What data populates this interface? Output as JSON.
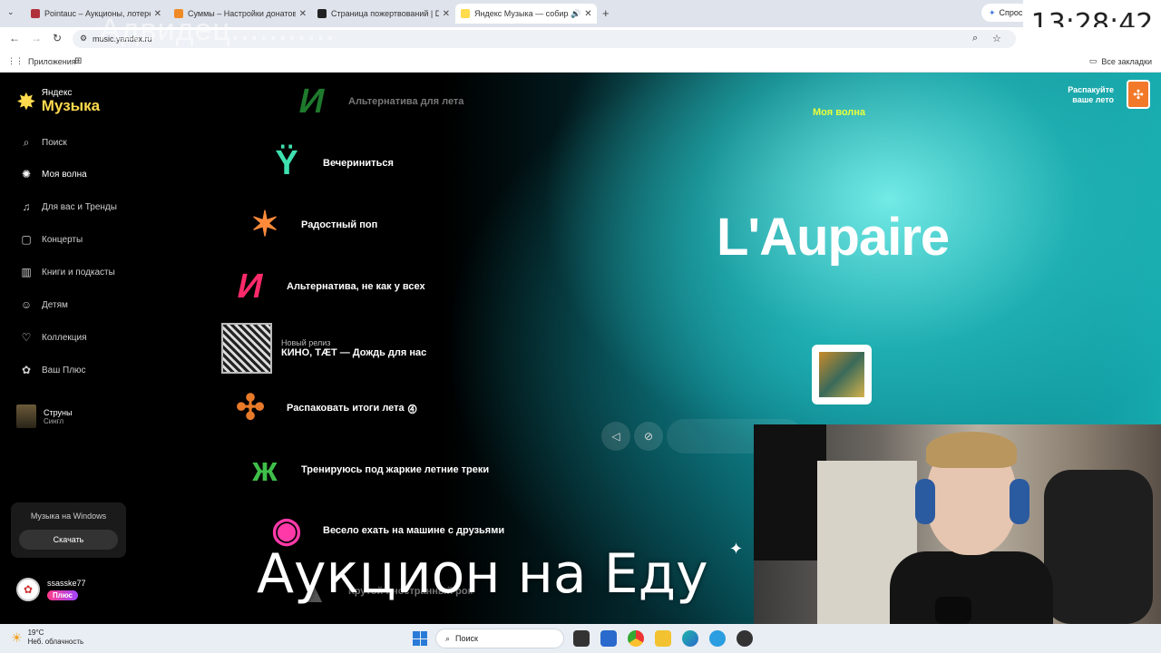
{
  "browser": {
    "tabs": [
      {
        "title": "Pointauc – Аукционы, лотереи",
        "color": "#b0303a",
        "active": false
      },
      {
        "title": "Суммы – Настройки донатов",
        "color": "#f08a24",
        "active": false
      },
      {
        "title": "Страница пожертвований | D",
        "color": "#222222",
        "active": false
      },
      {
        "title": "Яндекс Музыка — собирае",
        "color": "#ffdb4d",
        "active": true
      }
    ],
    "tab_close": "✕",
    "tab_new": "+",
    "gemini_label": "Спрос",
    "clock": "13:28:42",
    "address": "music.yandex.ru",
    "ghost_text": "Адвидец...........",
    "bookmarks_apps": "Приложения",
    "bookmarks_all": "Все закладки"
  },
  "sidebar": {
    "logo_top": "Яндекс",
    "logo_bottom": "Музыка",
    "items": [
      {
        "label": "Поиск",
        "icon": "⌕"
      },
      {
        "label": "Моя волна",
        "icon": "✺"
      },
      {
        "label": "Для вас и Тренды",
        "icon": "♫"
      },
      {
        "label": "Концерты",
        "icon": "▢"
      },
      {
        "label": "Книги и подкасты",
        "icon": "▥"
      },
      {
        "label": "Детям",
        "icon": "☺"
      },
      {
        "label": "Коллекция",
        "icon": "♡"
      },
      {
        "label": "Ваш Плюс",
        "icon": "✿"
      }
    ],
    "recent": {
      "title": "Струны",
      "subtitle": "Сингл"
    },
    "windows_card": {
      "title": "Музыка на Windows",
      "button": "Скачать"
    },
    "user": {
      "name": "ssasske77",
      "badge": "Плюс"
    }
  },
  "wave": {
    "items": [
      {
        "label": "Альтернатива для лета",
        "symbol": "И",
        "color": "#1e7a2c"
      },
      {
        "label": "Вечериниться",
        "symbol": "Ÿ",
        "color": "#3fe0b0"
      },
      {
        "label": "Радостный поп",
        "symbol": "✶",
        "color": "#ff8a3a"
      },
      {
        "label": "Альтернатива, не как у всех",
        "symbol": "И",
        "color": "#ff2a6a"
      },
      {
        "label": "Распаковать итоги лета",
        "symbol": "✣",
        "color": "#e87a2a"
      },
      {
        "label": "Тренируюсь под жаркие летние треки",
        "symbol": "ж",
        "color": "#3fbf4a"
      },
      {
        "label": "Весело ехать на машине с друзьями",
        "symbol": "◉",
        "color": "#ff3aa8"
      },
      {
        "label": "Крутой иностранный рок",
        "symbol": "▲",
        "color": "#555555"
      }
    ],
    "release": {
      "tag": "Новый релиз",
      "title": "КИНО, TÆT — Дождь для нас"
    },
    "badge_icon": "⓸"
  },
  "player": {
    "section": "Моя волна",
    "track": "L'Aupaire",
    "promo_line1": "Распакуйте",
    "promo_line2": "ваше лето"
  },
  "overlay_text": "Аукцион на Еду",
  "taskbar": {
    "temp": "19°C",
    "weather": "Неб. облачность",
    "search": "Поиск"
  }
}
